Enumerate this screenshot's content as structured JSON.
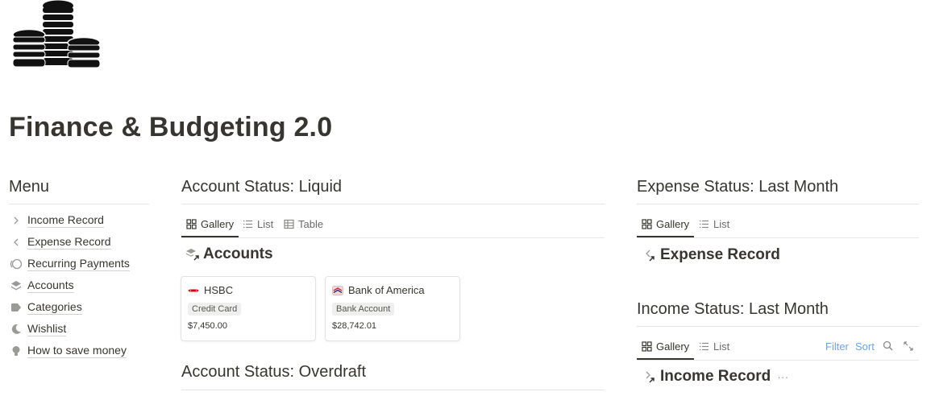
{
  "page": {
    "icon": "coins-stack-icon",
    "title": "Finance & Budgeting 2.0"
  },
  "menu": {
    "heading": "Menu",
    "items": [
      {
        "label": "Income Record",
        "icon": "chevron-right-icon"
      },
      {
        "label": "Expense Record",
        "icon": "chevron-left-icon"
      },
      {
        "label": "Recurring Payments",
        "icon": "recurring-circle-icon"
      },
      {
        "label": "Accounts",
        "icon": "layers-icon"
      },
      {
        "label": "Categories",
        "icon": "tag-icon"
      },
      {
        "label": "Wishlist",
        "icon": "moon-icon"
      },
      {
        "label": "How to save money",
        "icon": "lightbulb-icon"
      }
    ]
  },
  "liquid": {
    "heading": "Account Status: Liquid",
    "tabs": [
      "Gallery",
      "List",
      "Table"
    ],
    "db_title": "Accounts",
    "cards": [
      {
        "title": "HSBC",
        "tag": "Credit Card",
        "amount": "$7,450.00",
        "icon": "hsbc-logo-icon"
      },
      {
        "title": "Bank of America",
        "tag": "Bank Account",
        "amount": "$28,742.01",
        "icon": "bank-of-america-logo-icon"
      }
    ]
  },
  "overdraft": {
    "heading": "Account Status: Overdraft"
  },
  "expense": {
    "heading": "Expense Status: Last Month",
    "tabs": [
      "Gallery",
      "List"
    ],
    "db_title": "Expense Record"
  },
  "income": {
    "heading": "Income Status: Last Month",
    "tabs": [
      "Gallery",
      "List"
    ],
    "tools": [
      "Filter",
      "Sort"
    ],
    "db_title": "Income Record",
    "more": "···"
  },
  "colors": {
    "text": "#37352f",
    "muted": "#6b6b6b",
    "link": "#6fa3d9",
    "divider": "#e6e5e2"
  }
}
